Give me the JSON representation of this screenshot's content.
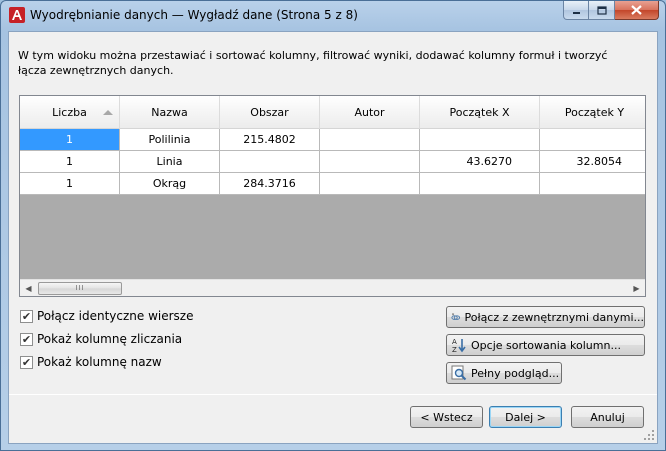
{
  "window": {
    "title": "Wyodrębnianie danych — Wygładź dane (Strona 5 z 8)"
  },
  "description": "W tym widoku można przestawiać i sortować kolumny, filtrować wyniki, dodawać kolumny formuł i tworzyć łącza zewnętrznych danych.",
  "table": {
    "columns": [
      "Liczba",
      "Nazwa",
      "Obszar",
      "Autor",
      "Początek X",
      "Początek Y"
    ],
    "sorted_column": "Liczba",
    "rows": [
      [
        "1",
        "Polilinia",
        "215.4802",
        "",
        "",
        ""
      ],
      [
        "1",
        "Linia",
        "",
        "",
        "43.6270",
        "32.8054"
      ],
      [
        "1",
        "Okrąg",
        "284.3716",
        "",
        "",
        ""
      ]
    ],
    "scroll_thumb_grip": "III"
  },
  "options": {
    "combine_rows": "Połącz identyczne wiersze",
    "show_count": "Pokaż kolumnę zliczania",
    "show_name": "Pokaż kolumnę nazw"
  },
  "side_buttons": {
    "link_external": "Połącz z zewnętrznymi danymi...",
    "sort_options": "Opcje sortowania kolumn...",
    "full_preview": "Pełny podgląd..."
  },
  "footer": {
    "back": "< Wstecz",
    "next": "Dalej >",
    "cancel": "Anuluj"
  },
  "colors": {
    "selection": "#3399ff",
    "grid_background": "#ababab",
    "close_button": "#c3462a"
  }
}
